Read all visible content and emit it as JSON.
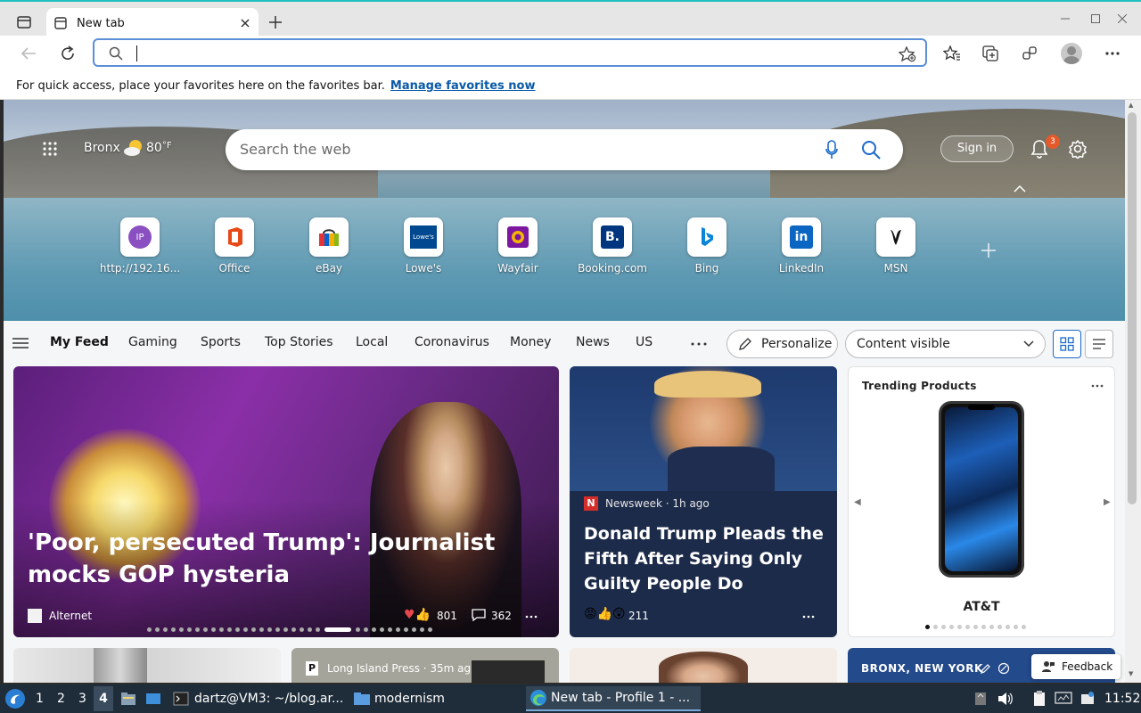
{
  "browser": {
    "tab_title": "New tab",
    "favbar_text": "For quick access, place your favorites here on the favorites bar.",
    "favbar_link": "Manage favorites now"
  },
  "ntp": {
    "location": "Bronx",
    "temp": "80",
    "temp_unit": "°F",
    "search_placeholder": "Search the web",
    "sign_in": "Sign in",
    "notif_count": "3",
    "quicklinks": [
      {
        "label": "http://192.16...",
        "icon": "ip-icon",
        "color": "#8a4fc0"
      },
      {
        "label": "Office",
        "icon": "office-icon",
        "color": "#e64a19"
      },
      {
        "label": "eBay",
        "icon": "ebay-icon",
        "color": "#0064d2"
      },
      {
        "label": "Lowe's",
        "icon": "lowes-icon",
        "color": "#004990"
      },
      {
        "label": "Wayfair",
        "icon": "wayfair-icon",
        "color": "#7b189f"
      },
      {
        "label": "Booking.com",
        "icon": "booking-icon",
        "color": "#003580"
      },
      {
        "label": "Bing",
        "icon": "bing-icon",
        "color": "#0a84d8"
      },
      {
        "label": "LinkedIn",
        "icon": "linkedin-icon",
        "color": "#0a66c2"
      },
      {
        "label": "MSN",
        "icon": "msn-icon",
        "color": "#111111"
      }
    ]
  },
  "feed": {
    "categories": [
      "My Feed",
      "Gaming",
      "Sports",
      "Top Stories",
      "Local",
      "Coronavirus",
      "Money",
      "News",
      "US"
    ],
    "personalize": "Personalize",
    "content_visible": "Content visible"
  },
  "cards": {
    "main": {
      "headline": "'Poor, persecuted Trump': Journalist mocks GOP hysteria",
      "source": "Alternet",
      "reactions": "801",
      "comments": "362"
    },
    "second": {
      "source": "Newsweek · 1h ago",
      "headline": "Donald Trump Pleads the Fifth After Saying Only Guilty People Do",
      "reactions": "211"
    },
    "trending": {
      "title": "Trending Products",
      "product_brand": "AT&T"
    },
    "row2": {
      "lipress": "Long Island Press · 35m ag",
      "weather_loc": "BRONX, NEW YORK",
      "feedback": "Feedback"
    }
  },
  "taskbar": {
    "workspaces": [
      "1",
      "2",
      "3",
      "4"
    ],
    "terminal": "dartz@VM3: ~/blog.ar...",
    "folder": "modernism",
    "browser_task": "New tab - Profile 1 - ...",
    "clock": "11:52"
  }
}
